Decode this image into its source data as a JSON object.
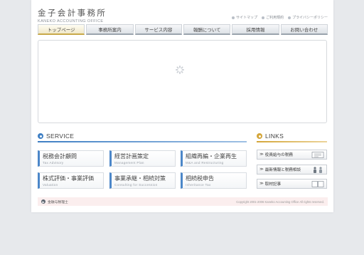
{
  "header": {
    "logo_title": "金子会計事務所",
    "logo_subtitle": "KANEKO ACCOUNTING OFFICE",
    "top_links": [
      "サイトマップ",
      "ご利用規約",
      "プライバシーポリシー"
    ]
  },
  "nav": {
    "items": [
      "トップページ",
      "事務所案内",
      "サービス内容",
      "報酬について",
      "採用情報",
      "お問い合わせ"
    ]
  },
  "service": {
    "title": "SERVICE",
    "items": [
      {
        "jp": "税務会計顧問",
        "en": "Tax Advisory"
      },
      {
        "jp": "経営計画策定",
        "en": "Management Plan"
      },
      {
        "jp": "組織再編・企業再生",
        "en": "M&A and Restructuring"
      },
      {
        "jp": "株式評価・事業評価",
        "en": "Valuation"
      },
      {
        "jp": "事業承継・相続対策",
        "en": "Consulting for Succession"
      },
      {
        "jp": "相続税申告",
        "en": "Inheritance Tax"
      }
    ]
  },
  "links": {
    "title": "LINKS",
    "items": [
      {
        "arrow": "≫",
        "label": "役員給与の税務"
      },
      {
        "arrow": "≫",
        "label": "最新情報と税務相談"
      },
      {
        "arrow": "≫",
        "label": "取材記事"
      }
    ]
  },
  "footer": {
    "link": "金融与税理士",
    "copyright": "Copyright 2001-2006 Kaneko Accounting Office All rights reserved."
  },
  "colors": {
    "service_accent": "#3f7fc4",
    "links_accent": "#d4a63a",
    "active_tab": "#c8a94a"
  }
}
